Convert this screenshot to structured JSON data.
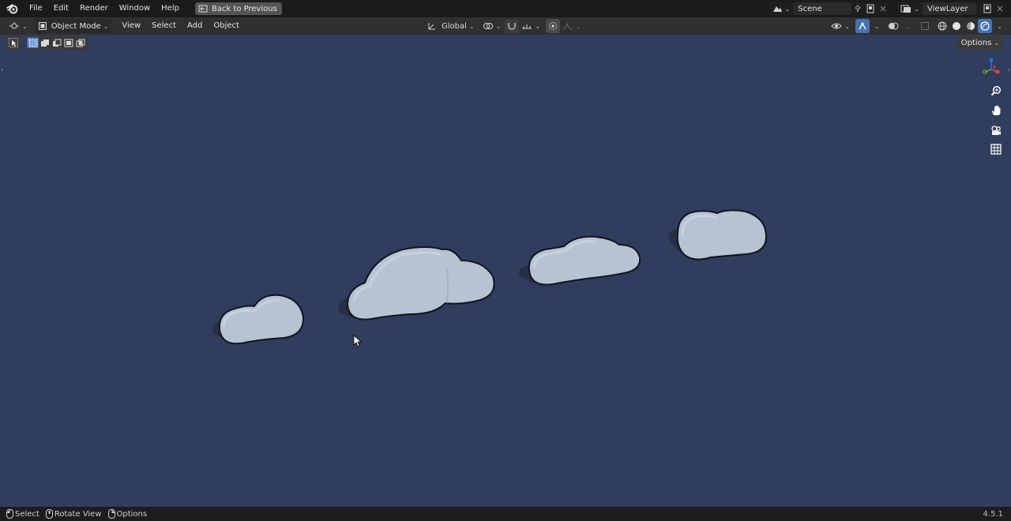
{
  "menu": {
    "items": [
      "File",
      "Edit",
      "Render",
      "Window",
      "Help"
    ],
    "back_button": "Back to Previous"
  },
  "top_right": {
    "scene": "Scene",
    "view_layer": "ViewLayer"
  },
  "viewport_header": {
    "mode": "Object Mode",
    "menus": [
      "View",
      "Select",
      "Add",
      "Object"
    ],
    "orientation": "Global"
  },
  "options_button": "Options",
  "status_bar": {
    "select": "Select",
    "rotate_view": "Rotate View",
    "options": "Options",
    "version": "4.5.1"
  },
  "colors": {
    "viewport_bg": "#303D5C",
    "cloud_fill": "#B9C4D2",
    "accent": "#4772B3"
  },
  "icons": {
    "logo": "blender-logo-icon",
    "zoom": "zoom-icon",
    "pan": "hand-pan-icon",
    "camera": "camera-view-icon",
    "grid": "ortho-grid-icon"
  }
}
